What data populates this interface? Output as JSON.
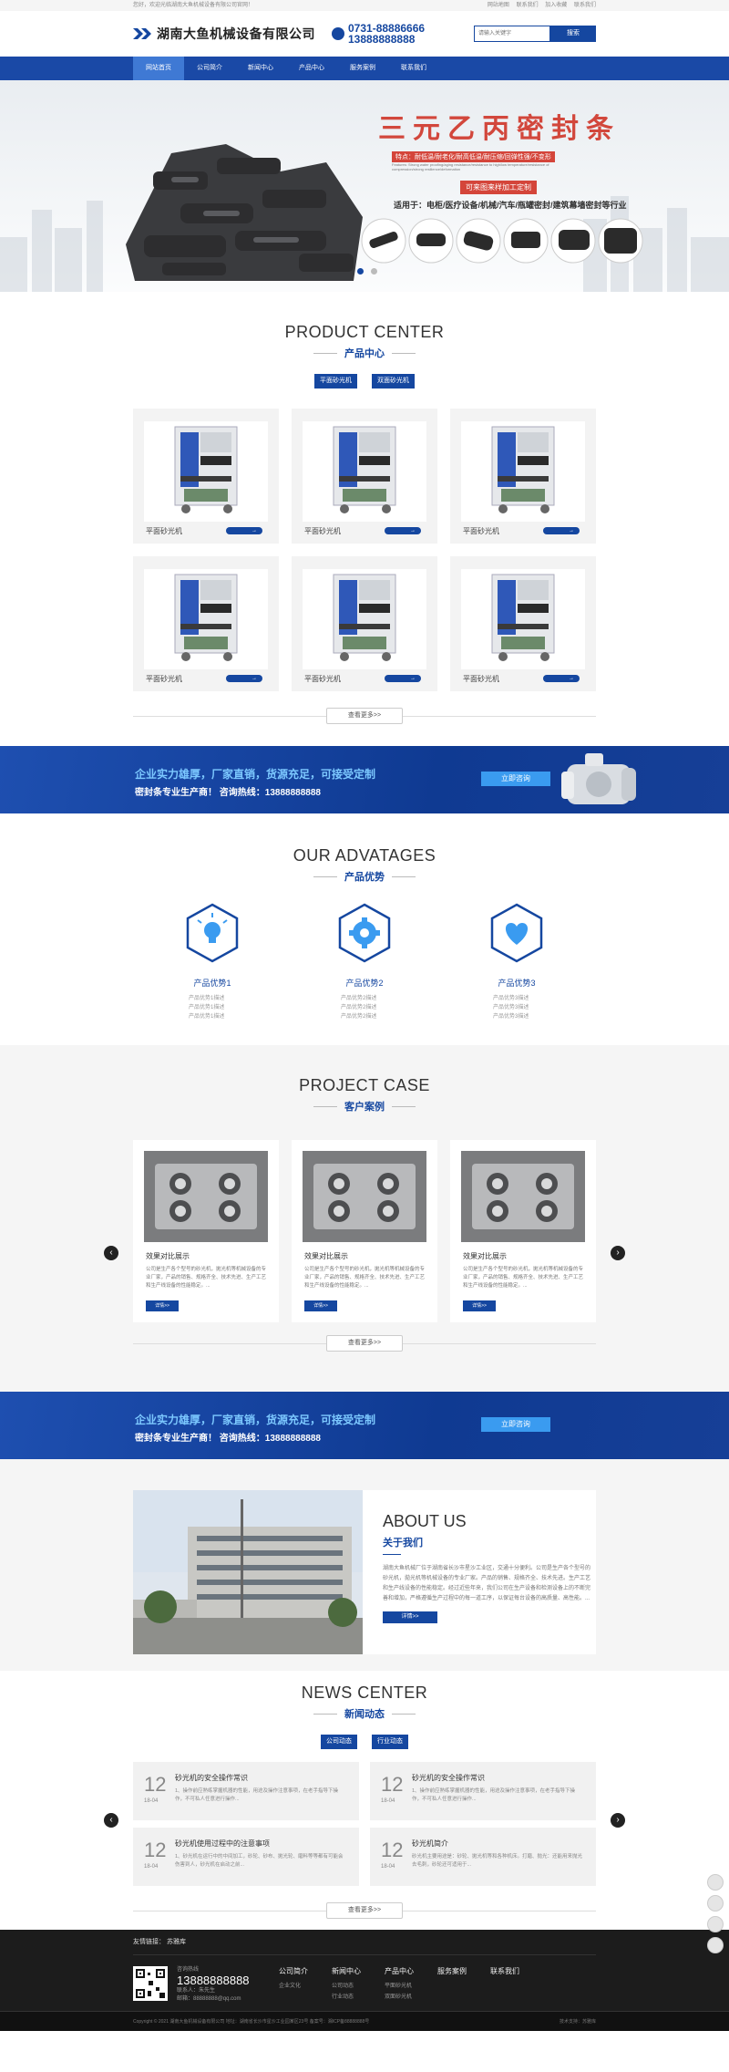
{
  "topbar": {
    "welcome": "您好，欢迎光临湖南大鱼机械设备有限公司官网！",
    "links": [
      "网站地图",
      "联系我们",
      "加入收藏",
      "联系我们"
    ]
  },
  "header": {
    "company_name": "湖南大鱼机械设备有限公司",
    "phone1": "0731-88886666",
    "phone2": "13888888888",
    "search_placeholder": "请输入关键字",
    "search_button": "搜索"
  },
  "nav": {
    "items": [
      "网站首页",
      "公司简介",
      "新闻中心",
      "产品中心",
      "服务案例",
      "联系我们"
    ],
    "active_index": 0
  },
  "banner": {
    "title": "三元乙丙密封条",
    "subtitle": "特点：耐低温/耐老化/耐高低温/耐压缩/回弹性强/不变形",
    "small_text": "Features: Strong water proofing/aging resistance/resistance to high/low temperature/resistance of compression/strong resilience/deformation",
    "badge": "可来图来样加工定制",
    "uses": "适用于：电柜/医疗设备/机械/汽车/瓶罐密封/建筑幕墙密封等行业",
    "dots": 2,
    "active_dot": 0
  },
  "products": {
    "en": "PRODUCT CENTER",
    "cn": "产品中心",
    "tabs": [
      "平面砂光机",
      "双面砂光机"
    ],
    "items": [
      {
        "label": "平面砂光机"
      },
      {
        "label": "平面砂光机"
      },
      {
        "label": "平面砂光机"
      },
      {
        "label": "平面砂光机"
      },
      {
        "label": "平面砂光机"
      },
      {
        "label": "平面砂光机"
      }
    ],
    "more": "查看更多>>"
  },
  "cta": {
    "line1": "企业实力雄厚，厂家直销，货源充足，可接受定制",
    "line2": "密封条专业生产商！ 咨询热线：13888888888",
    "button": "立即咨询"
  },
  "advantages": {
    "en": "OUR ADVATAGES",
    "cn": "产品优势",
    "items": [
      {
        "icon": "lightbulb-icon",
        "title": "产品优势1",
        "lines": [
          "产品优势1描述",
          "产品优势1描述",
          "产品优势1描述"
        ]
      },
      {
        "icon": "gear-icon",
        "title": "产品优势2",
        "lines": [
          "产品优势2描述",
          "产品优势2描述",
          "产品优势2描述"
        ]
      },
      {
        "icon": "heart-icon",
        "title": "产品优势3",
        "lines": [
          "产品优势3描述",
          "产品优势3描述",
          "产品优势3描述"
        ]
      }
    ]
  },
  "cases": {
    "en": "PROJECT CASE",
    "cn": "客户案例",
    "items": [
      {
        "title": "效果对比展示",
        "desc": "公司是生产各个型号的砂光机，拋光机等机械设备的专业厂家，产品的销售、规格齐全、技术先进、生产工艺和生产线设备的性能稳定。...",
        "button": "详情>>"
      },
      {
        "title": "效果对比展示",
        "desc": "公司是生产各个型号的砂光机，拋光机等机械设备的专业厂家，产品的销售、规格齐全、技术先进、生产工艺和生产线设备的性能稳定。...",
        "button": "详情>>"
      },
      {
        "title": "效果对比展示",
        "desc": "公司是生产各个型号的砂光机，拋光机等机械设备的专业厂家，产品的销售、规格齐全、技术先进、生产工艺和生产线设备的性能稳定。...",
        "button": "详情>>"
      }
    ],
    "more": "查看更多>>"
  },
  "about": {
    "en": "ABOUT US",
    "cn": "关于我们",
    "text": "湖南大鱼机械厂位于湖南省长沙市星沙工业区，交通十分便利。公司是生产各个型号的砂光机，拋光机等机械设备的专业厂家。产品的销售、规格齐全、技术先进。生产工艺和生产线设备的性能稳定。经过近些年来，我们公司在生产设备和检测设备上的不断完善和增加，严格遵循生产过程中的每一道工序，以保证每台设备的高质量、高性能。...",
    "button": "详情>>"
  },
  "news": {
    "en": "NEWS CENTER",
    "cn": "新闻动态",
    "tabs": [
      "公司动态",
      "行业动态"
    ],
    "items": [
      {
        "day": "12",
        "ym": "18-04",
        "title": "砂光机的安全操作常识",
        "desc": "1、操作前应熟练掌握机器的性能，用途及操作注意事项，在老手指导下操作，不可私人任意进行操作..."
      },
      {
        "day": "12",
        "ym": "18-04",
        "title": "砂光机的安全操作常识",
        "desc": "1、操作前应熟练掌握机器的性能，用途及操作注意事项，在老手指导下操作，不可私人任意进行操作..."
      },
      {
        "day": "12",
        "ym": "18-04",
        "title": "砂光机使用过程中的注意事项",
        "desc": "1、砂光机在运行中的中间加工，砂轮、砂布、拋光轮、磨料等等都有可能会伤害到人，砂光机在启动之前..."
      },
      {
        "day": "12",
        "ym": "18-04",
        "title": "砂光机简介",
        "desc": "砂光机主要用途是：砂轮、拋光机等和各种机床。打磨、抛光：还能用来抛光去毛刺，砂轮还可适用于..."
      }
    ],
    "more": "查看更多>>"
  },
  "footer": {
    "friend_label": "友情链接：",
    "friend_link": "苏雅库",
    "contact_label": "咨询热线",
    "tel": "13888888888",
    "contact_person": "联系人：朱先生",
    "email": "邮箱：88888888@qq.com",
    "cols": [
      {
        "title": "公司简介",
        "links": [
          "企业文化"
        ]
      },
      {
        "title": "新闻中心",
        "links": [
          "公司动态",
          "行业动态"
        ]
      },
      {
        "title": "产品中心",
        "links": [
          "平面砂光机",
          "双面砂光机"
        ]
      },
      {
        "title": "服务案例",
        "links": []
      },
      {
        "title": "联系我们",
        "links": []
      }
    ],
    "copyright": "Copyright © 2021 湖南大鱼机械设备有限公司  地址：湖南省长沙市星沙工业园某区23号  备案号：湘ICP备88888888号",
    "support": "技术支持：苏雅库"
  },
  "colors": {
    "primary": "#1547a0",
    "accent": "#3a9bf0",
    "banner_red": "#d2473c"
  }
}
